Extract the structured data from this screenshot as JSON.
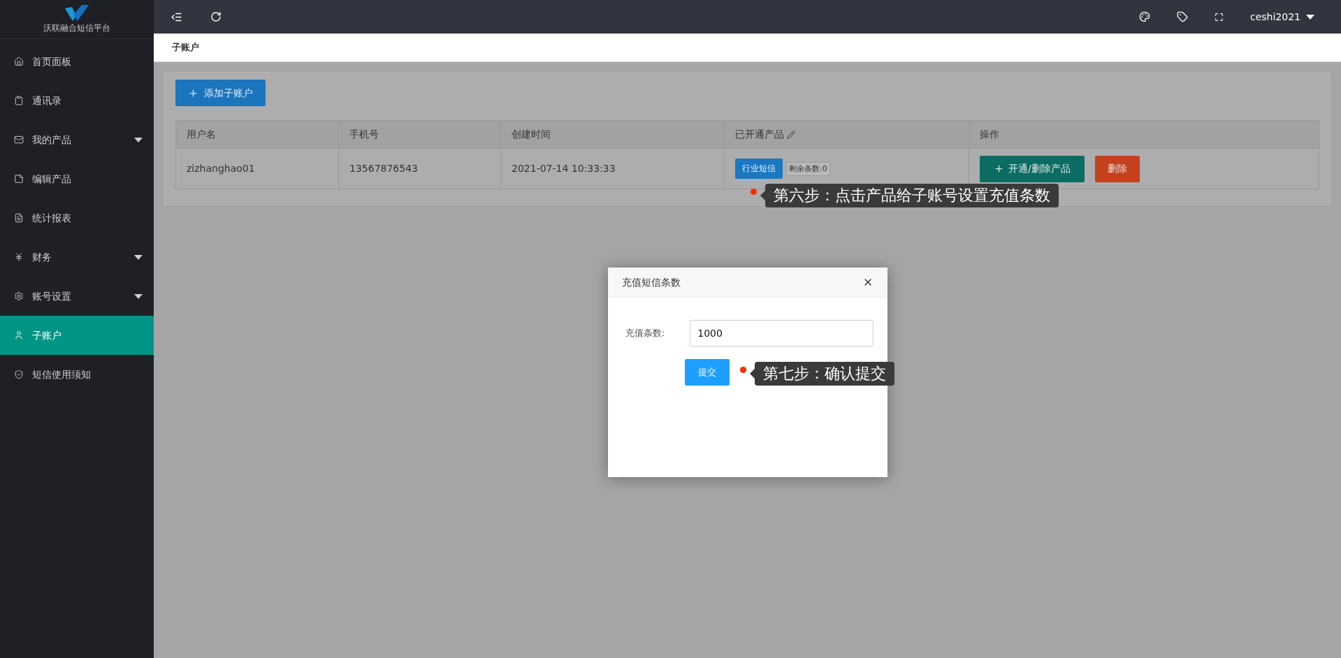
{
  "sidebar": {
    "logo_text": "沃联融合短信平台",
    "items": [
      {
        "label": "首页面板",
        "has_submenu": false,
        "selected": false
      },
      {
        "label": "通讯录",
        "has_submenu": false,
        "selected": false
      },
      {
        "label": "我的产品",
        "has_submenu": true,
        "selected": false
      },
      {
        "label": "编辑产品",
        "has_submenu": false,
        "selected": false
      },
      {
        "label": "统计报表",
        "has_submenu": false,
        "selected": false
      },
      {
        "label": "财务",
        "has_submenu": true,
        "selected": false
      },
      {
        "label": "账号设置",
        "has_submenu": true,
        "selected": false
      },
      {
        "label": "子账户",
        "has_submenu": false,
        "selected": true
      },
      {
        "label": "短信使用须知",
        "has_submenu": false,
        "selected": false
      }
    ]
  },
  "topbar": {
    "user": "ceshi2021"
  },
  "breadcrumb": "子账户",
  "add_button": "添加子账户",
  "table": {
    "columns": [
      "用户名",
      "手机号",
      "创建时间",
      "已开通产品",
      "操作"
    ],
    "rows": [
      {
        "username": "zizhanghao01",
        "phone": "13567876543",
        "created": "2021-07-14 10:33:33",
        "products": [
          {
            "label": "行业短信",
            "remaining": "剩余条数:0"
          }
        ],
        "actions": [
          {
            "kind": "primary",
            "label": "开通/删除产品"
          },
          {
            "kind": "danger",
            "label": "删除"
          }
        ]
      }
    ]
  },
  "dialog": {
    "title": "充值短信条数",
    "field_label": "充值条数:",
    "field_value": "1000",
    "submit": "提交"
  },
  "annotations": [
    {
      "text": "第六步：点击产品给子账号设置充值条数"
    },
    {
      "text": "第七步：确认提交"
    }
  ]
}
